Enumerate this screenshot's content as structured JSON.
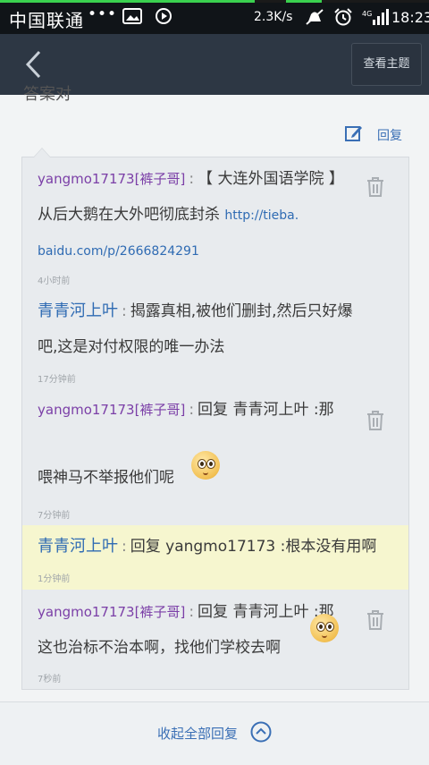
{
  "status_bar": {
    "carrier": "中国联通",
    "dots": "•••",
    "net_speed": "2.3K/s",
    "time": "18:23"
  },
  "title_bar": {
    "view_topic_label": "查看主题"
  },
  "content": {
    "cut_text": "答案对",
    "reply_label": "回复"
  },
  "replies": [
    {
      "user": "yangmo17173[裤子哥]",
      "line1": "【 大连外国语学院 】",
      "line2_text": "从后大鹅在大外吧彻底封杀",
      "line2_link": "http://tieba.",
      "line3_link": "baidu.com/p/2666824291",
      "time": "4小时前"
    },
    {
      "user": "青青河上叶",
      "line1": "揭露真相,被他们删封,然后只好爆",
      "line2": "吧,这是对付权限的唯一办法",
      "time": "17分钟前"
    },
    {
      "user": "yangmo17173[裤子哥]",
      "line1": "回复 青青河上叶 :那",
      "line2": "喂神马不举报他们呢",
      "time": "7分钟前"
    },
    {
      "user": "青青河上叶",
      "line1": "回复 yangmo17173 :根本没有用啊",
      "time": "1分钟前"
    },
    {
      "user": "yangmo17173[裤子哥]",
      "line1": "回复 青青河上叶 :那",
      "line2": "这也治标不治本啊，找他们学校去啊",
      "time": "7秒前"
    }
  ],
  "bottom": {
    "collapse_label": "收起全部回复"
  },
  "colors": {
    "accent_green": "#3ad14f",
    "title_bar": "#2d3744",
    "link_blue": "#2f6bb3",
    "username_purple": "#7b3fa7",
    "highlight_row": "#f6f6cf"
  }
}
